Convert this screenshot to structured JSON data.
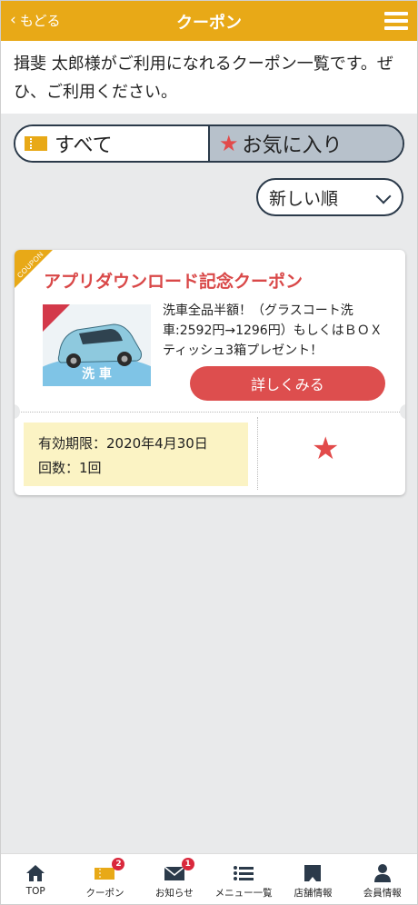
{
  "header": {
    "back_label": "もどる",
    "title": "クーポン"
  },
  "intro": {
    "text": "揖斐 太郎様がご利用になれるクーポン一覧です。ぜひ、ご利用ください。"
  },
  "tabs": [
    {
      "label": "すべて",
      "icon": "ticket-icon",
      "selected": true
    },
    {
      "label": "お気に入り",
      "icon": "star-icon",
      "selected": false
    }
  ],
  "sort": {
    "selected": "新しい順"
  },
  "coupon": {
    "ribbon": "COUPON",
    "title": "アプリダウンロード記念クーポン",
    "image_caption": "洗 車",
    "description": "洗車全品半額！（グラスコート洗車:2592円→1296円）もしくはＢＯＸティッシュ3箱プレゼント！",
    "detail_button": "詳しくみる",
    "expiry": "有効期限：2020年4月30日",
    "uses": "回数：1回",
    "favorite": true
  },
  "bottom_nav": [
    {
      "label": "TOP",
      "icon": "home-icon"
    },
    {
      "label": "クーポン",
      "icon": "ticket-icon",
      "badge": "2"
    },
    {
      "label": "お知らせ",
      "icon": "mail-icon",
      "badge": "1"
    },
    {
      "label": "メニュー一覧",
      "icon": "list-icon"
    },
    {
      "label": "店舗情報",
      "icon": "shop-icon"
    },
    {
      "label": "会員情報",
      "icon": "person-icon"
    }
  ],
  "colors": {
    "header": "#e8a917",
    "accent_red": "#dd4e4e",
    "background": "#e9eaeb"
  }
}
